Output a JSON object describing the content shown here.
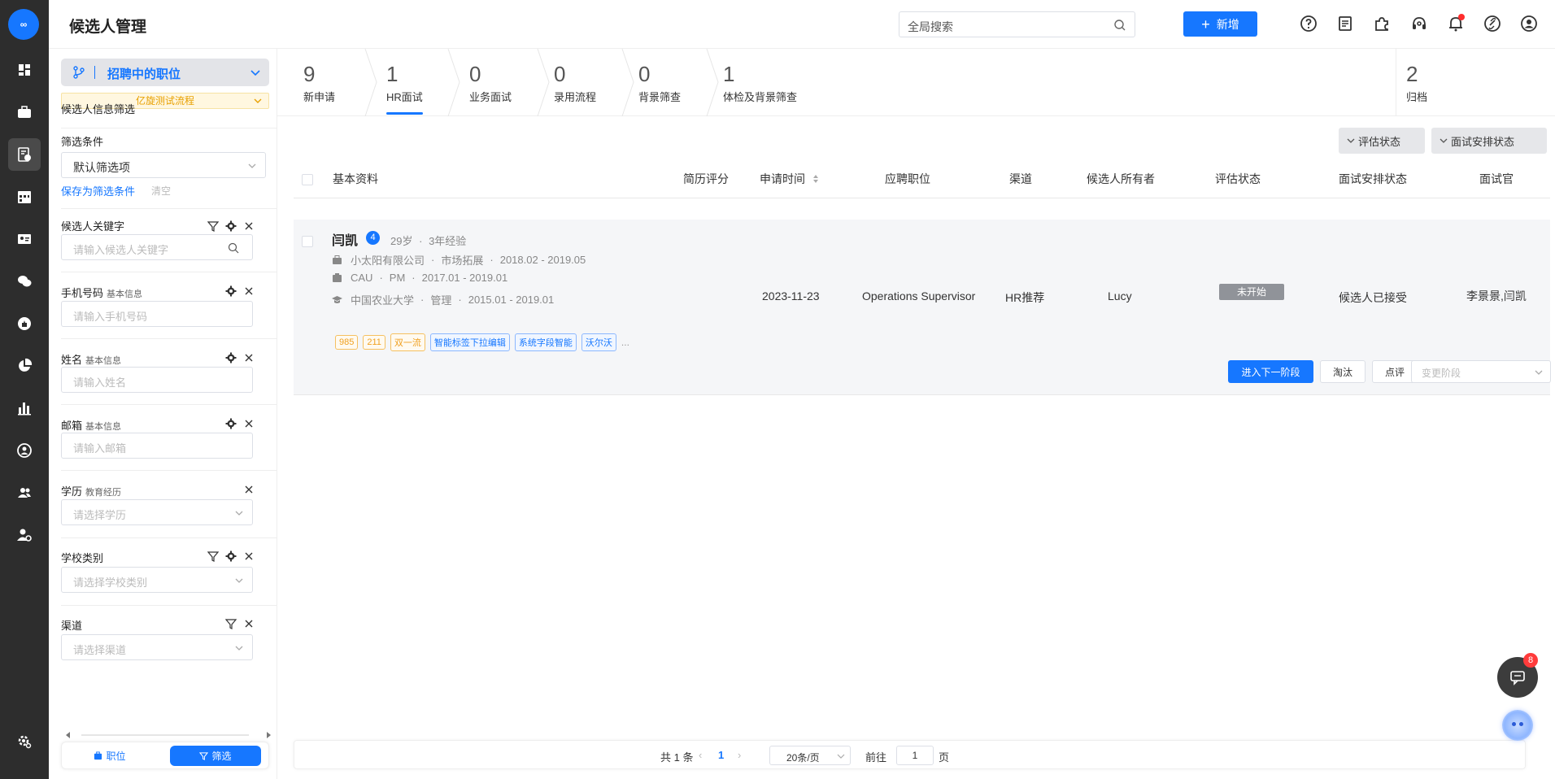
{
  "app": {
    "title": "候选人管理",
    "logo_text": "∞"
  },
  "header": {
    "search_placeholder": "全局搜索",
    "add_label": "新增",
    "icons": [
      "help-icon",
      "document-icon",
      "plugin-icon",
      "headset-icon",
      "bell-icon",
      "link-icon",
      "user-icon"
    ]
  },
  "rail": {
    "icons": [
      "dashboard-icon",
      "briefcase-icon",
      "candidate-icon",
      "calendar-icon",
      "id-card-icon",
      "wechat-icon",
      "talent-icon",
      "pie-chart-icon",
      "bar-chart-icon",
      "person-circle-icon",
      "team-icon",
      "user-settings-icon",
      "settings-icon"
    ]
  },
  "filter": {
    "position_label": "招聘中的职位",
    "flow_label": "亿旋测试流程",
    "section_title": "候选人信息筛选",
    "conditions_label": "筛选条件",
    "conditions_value": "默认筛选项",
    "save_label": "保存为筛选条件",
    "clear_label": "清空",
    "fields": [
      {
        "label": "候选人关键字",
        "sub": "",
        "placeholder": "请输入候选人关键字"
      },
      {
        "label": "手机号码",
        "sub": "基本信息",
        "placeholder": "请输入手机号码"
      },
      {
        "label": "姓名",
        "sub": "基本信息",
        "placeholder": "请输入姓名"
      },
      {
        "label": "邮箱",
        "sub": "基本信息",
        "placeholder": "请输入邮箱"
      },
      {
        "label": "学历",
        "sub": "教育经历",
        "placeholder": "请选择学历"
      },
      {
        "label": "学校类别",
        "sub": "",
        "placeholder": "请选择学校类别"
      },
      {
        "label": "渠道",
        "sub": "",
        "placeholder": "请选择渠道"
      }
    ],
    "tab_position": "职位",
    "tab_filter": "筛选"
  },
  "stages": [
    {
      "count": "9",
      "label": "新申请"
    },
    {
      "count": "1",
      "label": "HR面试"
    },
    {
      "count": "0",
      "label": "业务面试"
    },
    {
      "count": "0",
      "label": "录用流程"
    },
    {
      "count": "0",
      "label": "背景筛查"
    },
    {
      "count": "1",
      "label": "体检及背景筛查"
    },
    {
      "count": "2",
      "label": "归档"
    }
  ],
  "toolbar": {
    "eval_status": "评估状态",
    "interview_status": "面试安排状态"
  },
  "table": {
    "headers": {
      "basic": "基本资料",
      "score": "简历评分",
      "date": "申请时间",
      "position": "应聘职位",
      "channel": "渠道",
      "owner": "候选人所有者",
      "eval": "评估状态",
      "schedule": "面试安排状态",
      "interviewer": "面试官"
    },
    "row": {
      "name": "闫凯",
      "badge": "4",
      "age": "29岁",
      "exp": "3年经验",
      "work_company": "小太阳有限公司",
      "work_dept": "市场拓展",
      "work_period": "2018.02 - 2019.05",
      "proj_name": "CAU",
      "proj_role": "PM",
      "proj_period": "2017.01 - 2019.01",
      "edu_school": "中国农业大学",
      "edu_major": "管理",
      "edu_period": "2015.01 - 2019.01",
      "tags": [
        "985",
        "211",
        "双一流",
        "智能标签下拉编辑",
        "系统字段智能",
        "沃尔沃"
      ],
      "more": "...",
      "date": "2023-11-23",
      "position": "Operations Supervisor",
      "channel": "HR推荐",
      "owner": "Lucy",
      "eval": "未开始",
      "schedule": "候选人已接受",
      "interviewer": "李景景,闫凯",
      "next_label": "进入下一阶段",
      "reject_label": "淘汰",
      "comment_label": "点评",
      "change_placeholder": "变更阶段"
    }
  },
  "pager": {
    "total": "共 1 条",
    "current": "1",
    "page_size": "20条/页",
    "goto_prefix": "前往",
    "goto_value": "1",
    "goto_suffix": "页"
  },
  "chat": {
    "count": "8"
  },
  "colors": {
    "primary": "#1677ff",
    "rail": "#2d2d2d",
    "flow": "#e8a000"
  }
}
